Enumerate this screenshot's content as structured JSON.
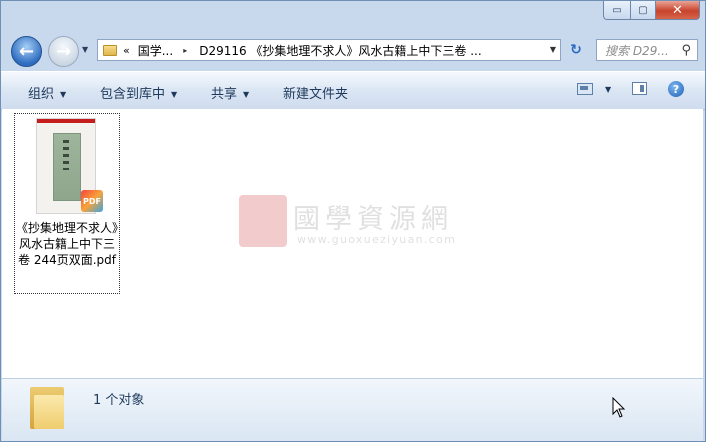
{
  "window": {
    "caption_buttons": {
      "minimize": "▭",
      "maximize": "▢",
      "close": "✕"
    }
  },
  "nav": {
    "back_glyph": "←",
    "forward_glyph": "→",
    "history_dropdown_glyph": "▼"
  },
  "address": {
    "overflow": "«",
    "crumbs": [
      "国学...",
      "D29116 《抄集地理不求人》风水古籍上中下三卷 ..."
    ],
    "separator_glyph": "▸",
    "dropdown_glyph": "▼",
    "refresh_glyph": "↻"
  },
  "search": {
    "placeholder": "搜索 D29...",
    "icon": "magnifier-icon",
    "glyph": "⚲"
  },
  "toolbar": {
    "organize": "组织",
    "include_in_library": "包含到库中",
    "share": "共享",
    "new_folder": "新建文件夹",
    "arrow_glyph": "▼",
    "view_arrow_glyph": "▼",
    "help_glyph": "?"
  },
  "files": [
    {
      "name": "《抄集地理不求人》风水古籍上中下三卷 244页双面.pdf",
      "type": "pdf",
      "badge": "PDF"
    }
  ],
  "watermark": {
    "title": "國學資源網",
    "url": "www.guoxueziyuan.com"
  },
  "status": {
    "count_text": "1 个对象"
  }
}
